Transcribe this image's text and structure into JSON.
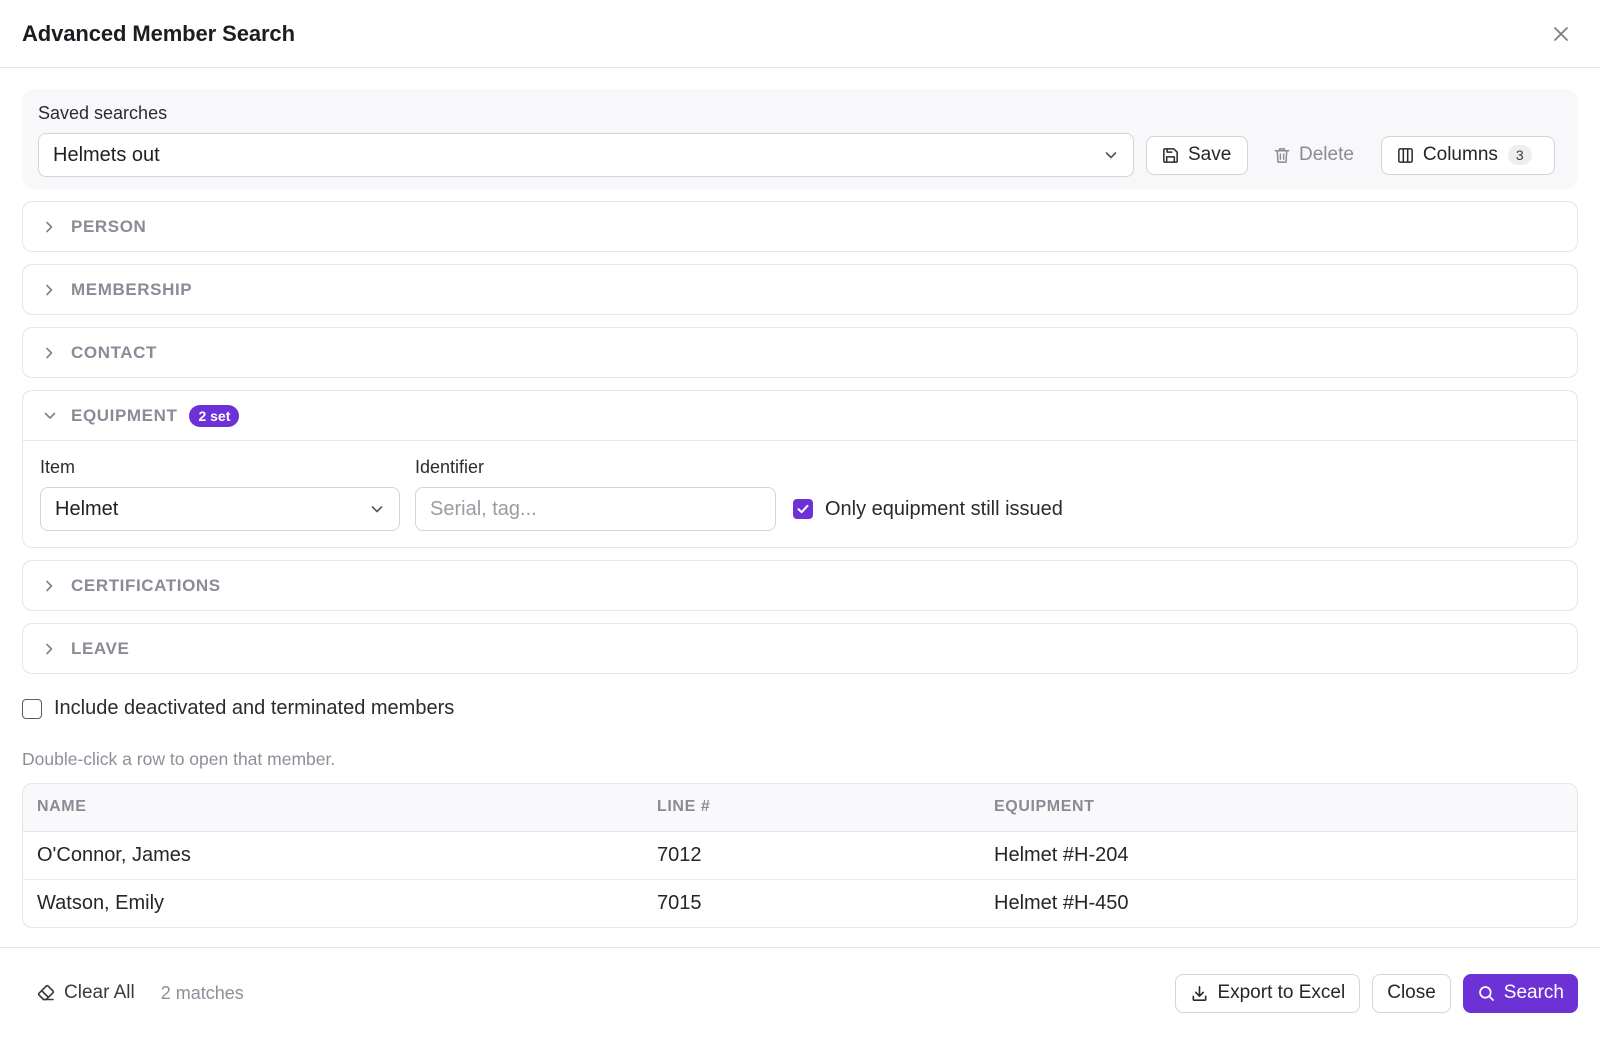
{
  "dialog": {
    "title": "Advanced Member Search"
  },
  "saved": {
    "label": "Saved searches",
    "selected": "Helmets out",
    "save_label": "Save",
    "delete_label": "Delete",
    "columns_label": "Columns",
    "columns_count": "3"
  },
  "sections": {
    "person": "PERSON",
    "membership": "MEMBERSHIP",
    "contact": "CONTACT",
    "equipment": "EQUIPMENT",
    "equipment_badge": "2 set",
    "certifications": "CERTIFICATIONS",
    "leave": "LEAVE"
  },
  "equipment": {
    "item_label": "Item",
    "item_value": "Helmet",
    "identifier_label": "Identifier",
    "identifier_placeholder": "Serial, tag...",
    "still_issued_label": "Only equipment still issued",
    "still_issued_checked": true
  },
  "include_deactivated": {
    "label": "Include deactivated and terminated members",
    "checked": false
  },
  "hint": "Double-click a row to open that member.",
  "table": {
    "headers": [
      "NAME",
      "LINE #",
      "EQUIPMENT"
    ],
    "rows": [
      [
        "O'Connor, James",
        "7012",
        "Helmet #H-204"
      ],
      [
        "Watson, Emily",
        "7015",
        "Helmet #H-450"
      ]
    ]
  },
  "footer": {
    "clear_label": "Clear All",
    "match_count": "2 matches",
    "export_label": "Export to Excel",
    "close_label": "Close",
    "search_label": "Search"
  },
  "colors": {
    "accent": "#6d32d6",
    "muted": "#8a8b96",
    "border": "#e5e5ea"
  }
}
